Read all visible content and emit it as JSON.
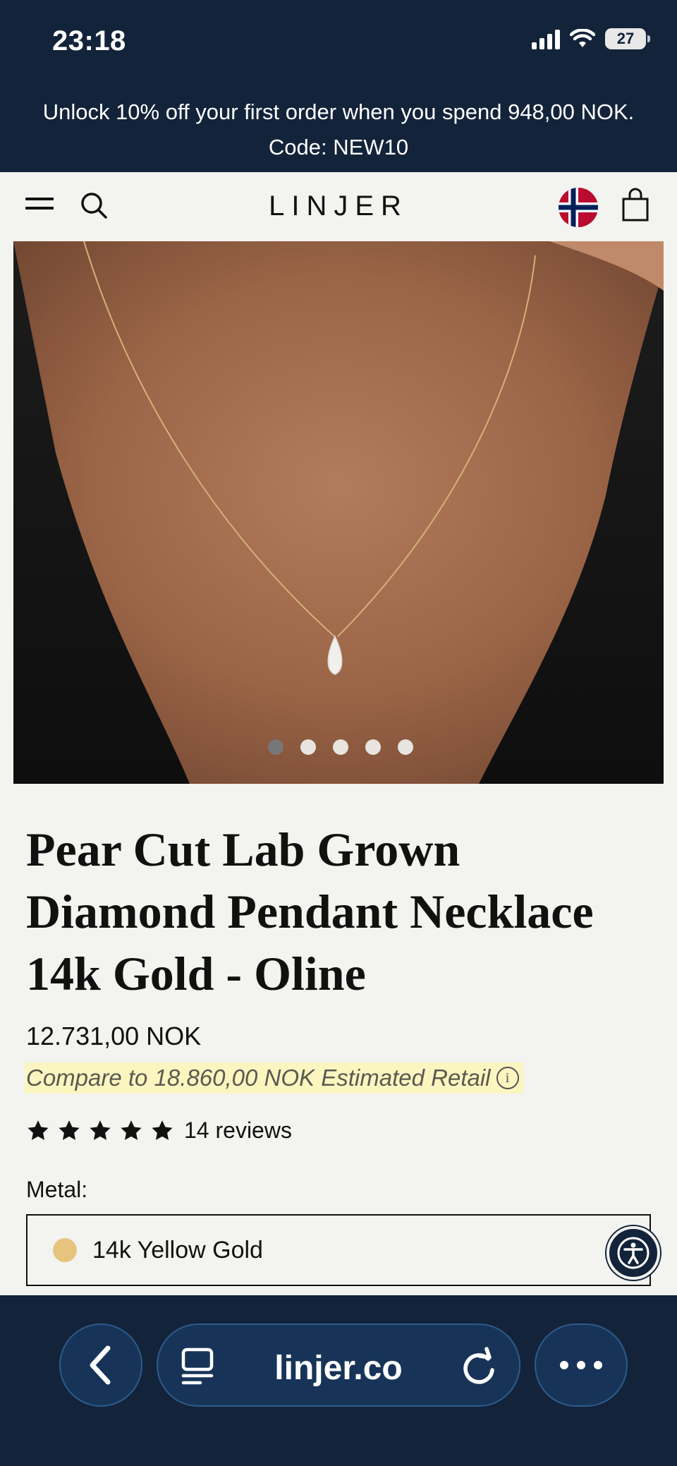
{
  "status_bar": {
    "time": "23:18",
    "battery": "27"
  },
  "promo": {
    "line1": "Unlock 10% off your first order when you spend 948,00 NOK.",
    "line2": "Code: NEW10"
  },
  "header": {
    "logo": "LINJER",
    "icons": [
      "menu-icon",
      "search-icon",
      "norway-flag-icon",
      "shopping-bag-icon"
    ]
  },
  "gallery": {
    "image_count": 5,
    "active_index": 0
  },
  "product": {
    "title_lines": [
      "Pear Cut Lab Grown",
      "Diamond Pendant Necklace",
      "14k Gold - Oline"
    ],
    "price": "12.731,00 NOK",
    "compare_text": "Compare to 18.860,00 NOK Estimated Retail",
    "rating": 5,
    "reviews_label": "14 reviews",
    "metal_label": "Metal:",
    "metal_value": "14k Yellow Gold",
    "metal_swatch_color": "#e6c47e"
  },
  "browser": {
    "url": "linjer.co"
  },
  "colors": {
    "navy": "#13233a",
    "highlight": "#fbf5c0",
    "background": "#f3f3ef"
  }
}
